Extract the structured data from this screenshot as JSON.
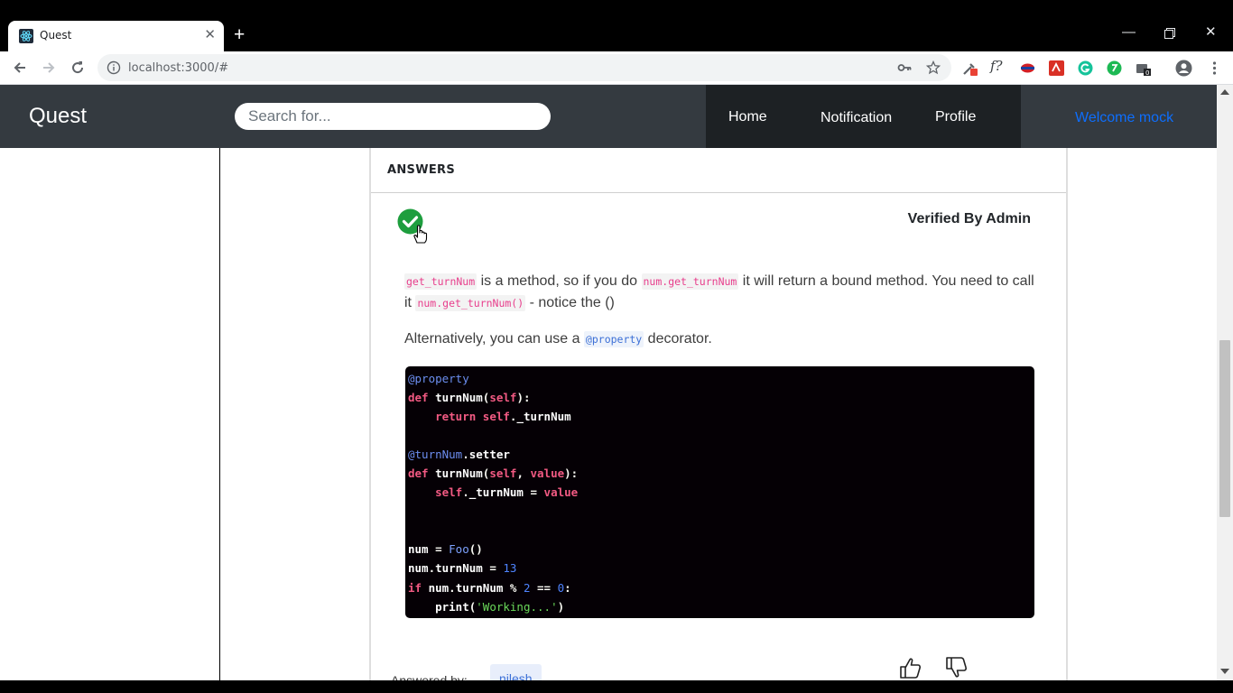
{
  "browser": {
    "tab_title": "Quest",
    "url": "localhost:3000/#"
  },
  "navbar": {
    "brand": "Quest",
    "search_placeholder": "Search for...",
    "links": [
      "Home",
      "Notification",
      "Profile"
    ],
    "welcome": "Welcome mock"
  },
  "answers": {
    "heading": "ANSWERS",
    "verified": "Verified By Admin",
    "para1": {
      "code1": "get_turnNum",
      "text1": " is a method, so if you do ",
      "code2": "num.get_turnNum",
      "text2": " it will return a bound method. You need to call it ",
      "code3": "num.get_turnNum()",
      "text3": " - notice the ()"
    },
    "para2": {
      "text1": "Alternatively, you can use a ",
      "code1": "@property",
      "text2": " decorator."
    },
    "code_lines": [
      "@property",
      "def turnNum(self):",
      "    return self._turnNum",
      "",
      "@turnNum.setter",
      "def turnNum(self, value):",
      "    self._turnNum = value",
      "",
      "",
      "num = Foo()",
      "num.turnNum = 13",
      "if num.turnNum % 2 == 0:",
      "    print('Working...')"
    ],
    "answered_by_label": "Answered by:",
    "author": "nilesh"
  },
  "colors": {
    "navbar_bg": "#343a40",
    "nav_menu_bg": "#1d2124",
    "welcome": "#0d6efd",
    "verified_check": "#1e9e3e",
    "code_bg": "#050005"
  }
}
